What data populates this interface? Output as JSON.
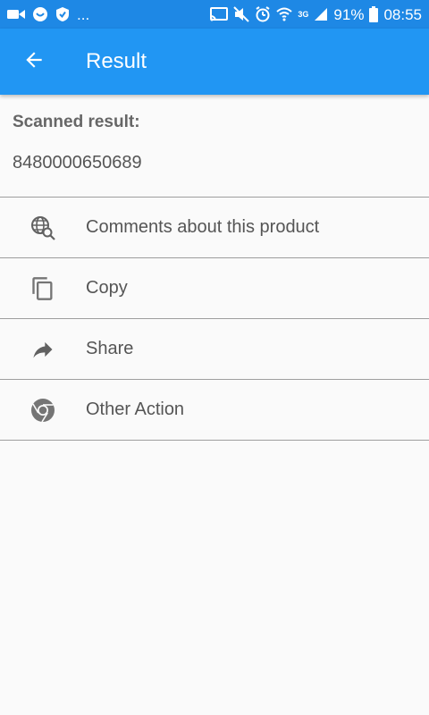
{
  "status_bar": {
    "icons_left": [
      "video-icon",
      "app-icon",
      "shield-icon"
    ],
    "more": "...",
    "network": "3G",
    "battery": "91%",
    "time": "08:55"
  },
  "appbar": {
    "title": "Result"
  },
  "result": {
    "label": "Scanned result:",
    "value": "8480000650689"
  },
  "actions": [
    {
      "label": "Comments about this product",
      "icon": "globe-search-icon"
    },
    {
      "label": "Copy",
      "icon": "copy-icon"
    },
    {
      "label": "Share",
      "icon": "share-icon"
    },
    {
      "label": "Other Action",
      "icon": "chrome-icon"
    }
  ],
  "colors": {
    "status_bar": "#1e88e5",
    "app_bar": "#2196f3",
    "background": "#fafafa",
    "text": "#555555",
    "icon": "#757575"
  }
}
